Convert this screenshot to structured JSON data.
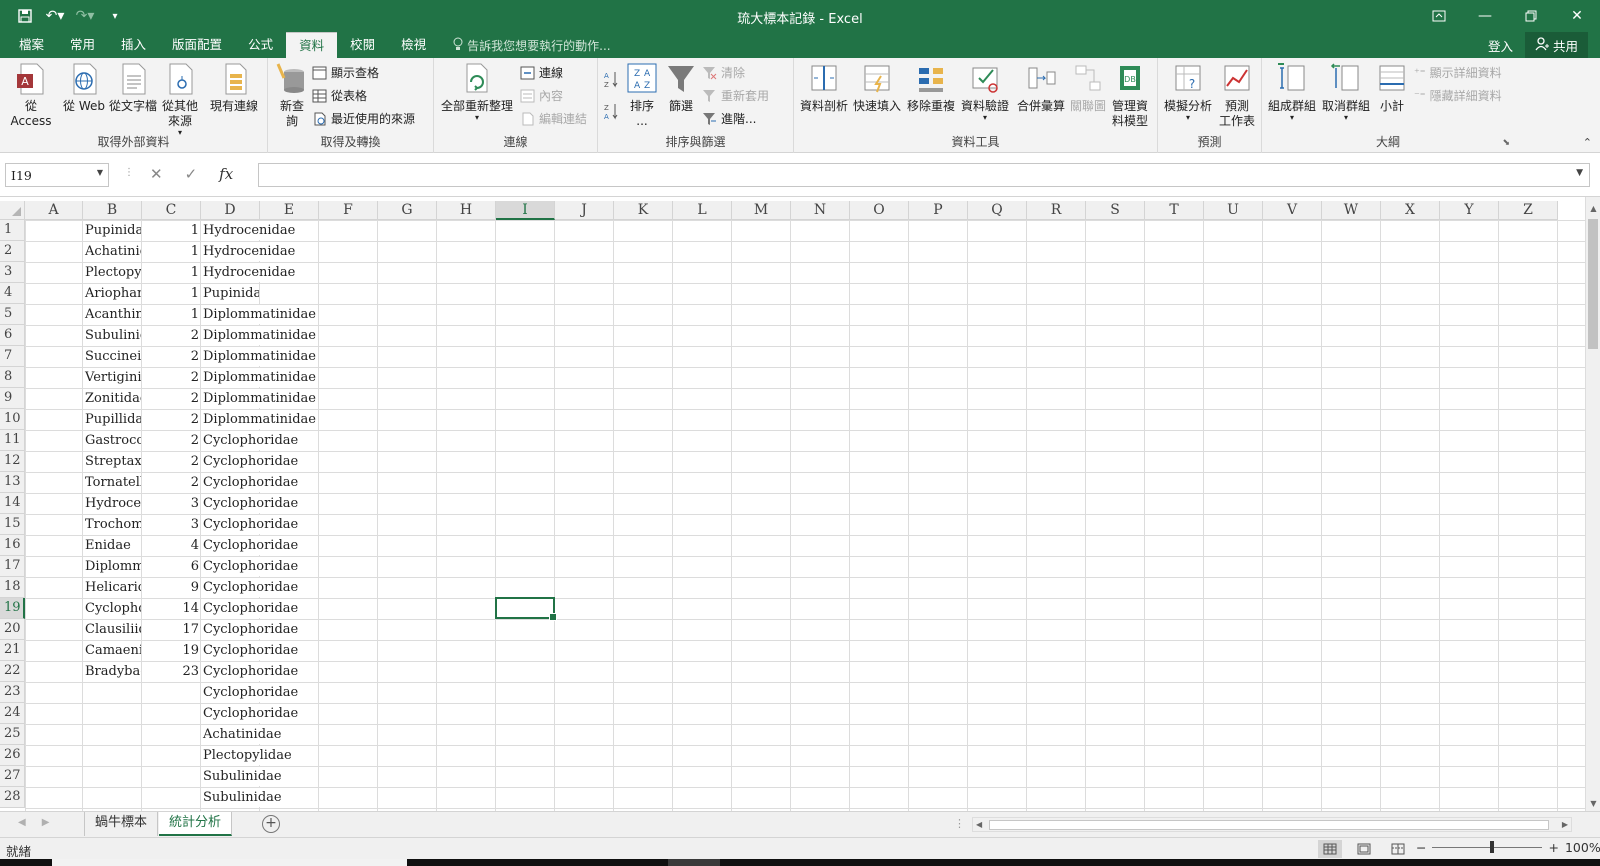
{
  "window": {
    "title": "琉大標本記錄 - Excel",
    "accent": "#217346"
  },
  "tabs": [
    {
      "label": "檔案"
    },
    {
      "label": "常用"
    },
    {
      "label": "插入"
    },
    {
      "label": "版面配置"
    },
    {
      "label": "公式"
    },
    {
      "label": "資料",
      "active": true
    },
    {
      "label": "校閱"
    },
    {
      "label": "檢視"
    }
  ],
  "tellme": "告訴我您想要執行的動作...",
  "account": {
    "signin": "登入",
    "share": "共用"
  },
  "ribbon": {
    "ext": {
      "label": "取得外部資料",
      "access": "從 Access",
      "web": "從 Web",
      "text": "從文字檔",
      "other1": "從其他",
      "other2": "來源",
      "existing": "現有連線"
    },
    "transform": {
      "label": "取得及轉換",
      "newquery1": "新查",
      "newquery2": "詢",
      "showq": "顯示查格",
      "fromtable": "從表格",
      "recent": "最近使用的來源"
    },
    "conn": {
      "label": "連線",
      "refresh": "全部重新整理",
      "links": "連線",
      "props": "內容",
      "editlinks": "編輯連結"
    },
    "sort": {
      "label": "排序與篩選",
      "sort1": "排序",
      "sort2": "...",
      "filter": "篩選",
      "clear": "清除",
      "reapply": "重新套用",
      "advanced": "進階..."
    },
    "tools": {
      "label": "資料工具",
      "ttc": "資料剖析",
      "flash": "快速填入",
      "dup": "移除重複",
      "valid": "資料驗證",
      "consol": "合併彙算",
      "rel": "關聯圖",
      "model1": "管理資",
      "model2": "料模型"
    },
    "forecast": {
      "label": "預測",
      "whatif": "模擬分析",
      "sheet1": "預測",
      "sheet2": "工作表"
    },
    "outline": {
      "label": "大綱",
      "group": "組成群組",
      "ungroup": "取消群組",
      "subtotal": "小計",
      "show": "顯示詳細資料",
      "hide": "隱藏詳細資料"
    }
  },
  "namebox": "I19",
  "columns": [
    "A",
    "B",
    "C",
    "D",
    "E",
    "F",
    "G",
    "H",
    "I",
    "J",
    "K",
    "L",
    "M",
    "N",
    "O",
    "P",
    "Q",
    "R",
    "S",
    "T",
    "U",
    "V",
    "W",
    "X",
    "Y",
    "Z"
  ],
  "selected_column": "I",
  "selected_row": 19,
  "rows": [
    {
      "n": 1,
      "b": "Pupinidae",
      "c": "1",
      "d": "Hydrocenidae"
    },
    {
      "n": 2,
      "b": "Achatinida",
      "c": "1",
      "d": "Hydrocenidae"
    },
    {
      "n": 3,
      "b": "Plectopyli",
      "c": "1",
      "d": "Hydrocenidae"
    },
    {
      "n": 4,
      "b": "Ariophant",
      "c": "1",
      "d": "Pupinidae"
    },
    {
      "n": 5,
      "b": "Acanthinu",
      "c": "1",
      "d": "Diplommatinidae"
    },
    {
      "n": 6,
      "b": "Subulinida",
      "c": "2",
      "d": "Diplommatinidae"
    },
    {
      "n": 7,
      "b": "Succineida",
      "c": "2",
      "d": "Diplommatinidae"
    },
    {
      "n": 8,
      "b": "Vertiginid",
      "c": "2",
      "d": "Diplommatinidae"
    },
    {
      "n": 9,
      "b": "Zonitidae",
      "c": "2",
      "d": "Diplommatinidae"
    },
    {
      "n": 10,
      "b": "Pupillidae",
      "c": "2",
      "d": "Diplommatinidae"
    },
    {
      "n": 11,
      "b": "Gastrocop",
      "c": "2",
      "d": "Cyclophoridae"
    },
    {
      "n": 12,
      "b": "Streptaxid",
      "c": "2",
      "d": "Cyclophoridae"
    },
    {
      "n": 13,
      "b": "Tornatelli",
      "c": "2",
      "d": "Cyclophoridae"
    },
    {
      "n": 14,
      "b": "Hydroceni",
      "c": "3",
      "d": "Cyclophoridae"
    },
    {
      "n": 15,
      "b": "Trochomo",
      "c": "3",
      "d": "Cyclophoridae"
    },
    {
      "n": 16,
      "b": "Enidae",
      "c": "4",
      "d": "Cyclophoridae"
    },
    {
      "n": 17,
      "b": "Diplomma",
      "c": "6",
      "d": "Cyclophoridae"
    },
    {
      "n": 18,
      "b": "Helicarion",
      "c": "9",
      "d": "Cyclophoridae"
    },
    {
      "n": 19,
      "b": "Cyclophor",
      "c": "14",
      "d": "Cyclophoridae"
    },
    {
      "n": 20,
      "b": "Clausiliid",
      "c": "17",
      "d": "Cyclophoridae"
    },
    {
      "n": 21,
      "b": "Camaenid",
      "c": "19",
      "d": "Cyclophoridae"
    },
    {
      "n": 22,
      "b": "Bradybaer",
      "c": "23",
      "d": "Cyclophoridae"
    },
    {
      "n": 23,
      "b": "",
      "c": "",
      "d": "Cyclophoridae"
    },
    {
      "n": 24,
      "b": "",
      "c": "",
      "d": "Cyclophoridae"
    },
    {
      "n": 25,
      "b": "",
      "c": "",
      "d": "Achatinidae"
    },
    {
      "n": 26,
      "b": "",
      "c": "",
      "d": "Plectopylidae"
    },
    {
      "n": 27,
      "b": "",
      "c": "",
      "d": "Subulinidae"
    },
    {
      "n": 28,
      "b": "",
      "c": "",
      "d": "Subulinidae"
    }
  ],
  "sheets": [
    {
      "label": "蝸牛標本",
      "active": false
    },
    {
      "label": "統計分析",
      "active": true
    }
  ],
  "status": {
    "mode": "就緒",
    "zoom": "100%"
  }
}
